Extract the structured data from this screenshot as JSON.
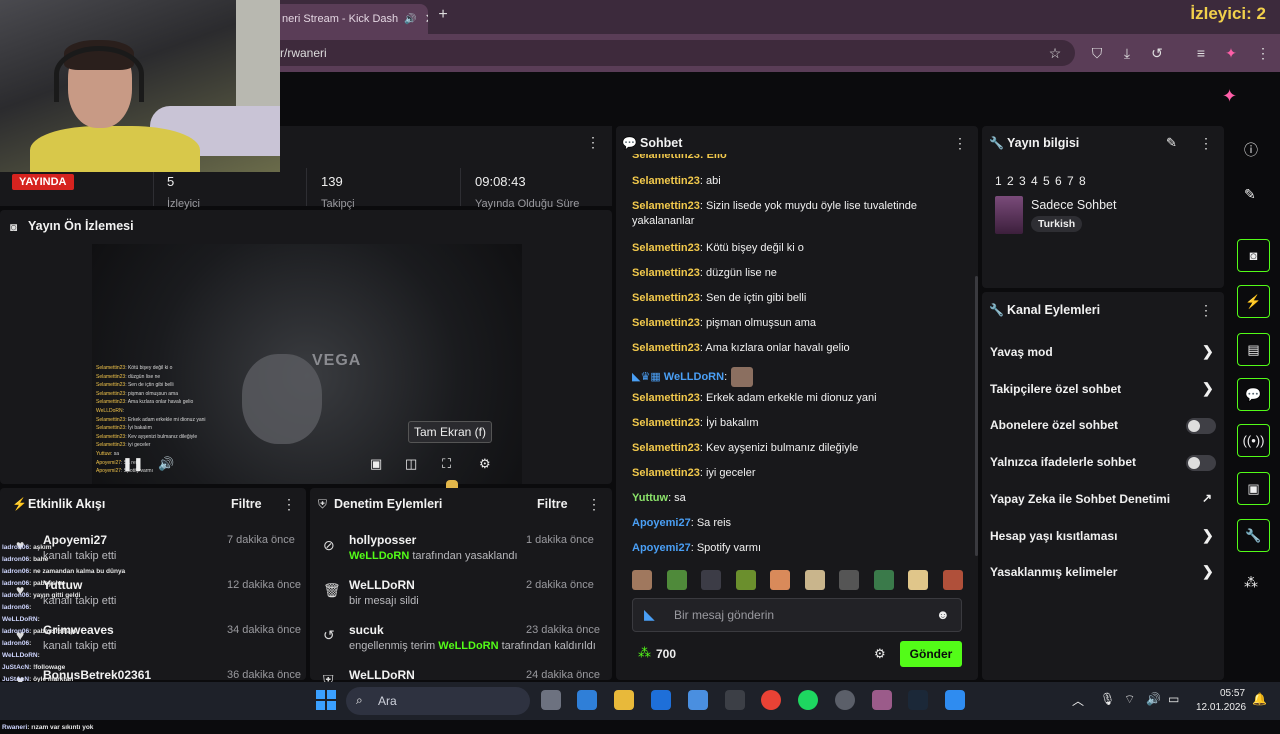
{
  "browser": {
    "tab_title": "neri Stream - Kick Dash",
    "url": "tor/rwaneri",
    "viewer_overlay": "İzleyici: 2"
  },
  "stats": {
    "live_label": "YAYINDA",
    "viewers_value": "5",
    "viewers_label": "İzleyici",
    "followers_value": "139",
    "followers_label": "Takipçi",
    "duration_value": "09:08:43",
    "duration_label": "Yayında Olduğu Süre"
  },
  "preview": {
    "title": "Yayın Ön İzlemesi",
    "vega_text": "VEGA",
    "tooltip": "Tam Ekran (f)",
    "chat_lines": [
      {
        "n": "Selamettin23",
        "t": ": Kötü bişey değil ki o"
      },
      {
        "n": "Selamettin23",
        "t": ": düzgün lise ne"
      },
      {
        "n": "Selamettin23",
        "t": ": Sen de içtin gibi belli"
      },
      {
        "n": "Selamettin23",
        "t": ": pişman olmuşsun ama"
      },
      {
        "n": "Selamettin23",
        "t": ": Ama kızlara onlar havalı gelio"
      },
      {
        "n": "WeLLDoRN",
        "t": ":"
      },
      {
        "n": "Selamettin23",
        "t": ": Erkek adam erkekle mi dionuz yani"
      },
      {
        "n": "Selamettin23",
        "t": ": İyi bakalım"
      },
      {
        "n": "Selamettin23",
        "t": ": Kev ayşenizi bulmanız dileğiyle"
      },
      {
        "n": "Selamettin23",
        "t": ": iyi geceler"
      },
      {
        "n": "Yuttuw",
        "t": ": sa"
      },
      {
        "n": "Apoyemi27",
        "t": ": Sa reis"
      },
      {
        "n": "Apoyemi27",
        "t": ": Spotify varmı"
      }
    ]
  },
  "activity": {
    "title": "Etkinlik Akışı",
    "filter": "Filtre",
    "events": [
      {
        "name": "Apoyemi27",
        "sub": "kanalı takip etti",
        "time": "7 dakika önce"
      },
      {
        "name": "Yuttuw",
        "sub": "kanalı takip etti",
        "time": "12 dakika önce"
      },
      {
        "name": "Grimweaves",
        "sub": "kanalı takip etti",
        "time": "34 dakika önce"
      },
      {
        "name": "BonusBetrek02361",
        "sub": "",
        "time": "36 dakika önce"
      }
    ]
  },
  "overlay_chat": [
    {
      "n": "ladron06",
      "t": ": aşkım"
    },
    {
      "n": "ladron06",
      "t": ": bahe"
    },
    {
      "n": "ladron06",
      "t": ": ne zamandan kalma bu dünya"
    },
    {
      "n": "ladron06",
      "t": ": pabaysha"
    },
    {
      "n": "ladron06",
      "t": ": yayın gitti geldi"
    },
    {
      "n": "ladron06",
      "t": ":"
    },
    {
      "n": "WeLLDoRN",
      "t": ":"
    },
    {
      "n": "ladron06",
      "t": ": pabayshshajs"
    },
    {
      "n": "ladron06",
      "t": ":"
    },
    {
      "n": "WeLLDoRN",
      "t": ":"
    },
    {
      "n": "JuStAcN",
      "t": ": !followage"
    },
    {
      "n": "JuStAcN",
      "t": ": öyle marktan"
    },
    {
      "n": "JuStAcN",
      "t": ": tüm yayınlaeda gezip bakıcam yatıcam"
    },
    {
      "n": "JuStAcN",
      "t": ": merak ettim"
    },
    {
      "n": "JuStAcN",
      "t": ": ben kaçar bb"
    },
    {
      "n": "Rwaneri",
      "t": ": rızam var sıkıntı yok"
    }
  ],
  "moderation": {
    "title": "Denetim Eylemleri",
    "filter": "Filtre",
    "events": [
      {
        "name": "hollyposser",
        "who": "WeLLDoRN",
        "sub": " tarafından yasaklandı",
        "time": "1 dakika önce",
        "icon": "ban-icon"
      },
      {
        "name": "WeLLDoRN",
        "who": "",
        "sub": "bir mesajı sildi",
        "time": "2 dakika önce",
        "icon": "trash-icon"
      },
      {
        "name": "sucuk",
        "who": "",
        "sub": "engellenmiş terim ",
        "who2": "WeLLDoRN",
        "sub2": " tarafından kaldırıldı",
        "time": "23 dakika önce",
        "icon": "undo-icon"
      },
      {
        "name": "WeLLDoRN",
        "who": "",
        "sub": "",
        "time": "24 dakika önce",
        "icon": "shield-icon"
      }
    ]
  },
  "chat": {
    "title": "Sohbet",
    "messages": [
      {
        "u": "Selamettin23",
        "t": ": abi",
        "c": "y"
      },
      {
        "u": "Selamettin23",
        "t": ": Sizin lisede yok muydu öyle lise tuvaletinde yakalananlar",
        "c": "y"
      },
      {
        "u": "Selamettin23",
        "t": ": Kötü bişey değil ki o",
        "c": "y"
      },
      {
        "u": "Selamettin23",
        "t": ": düzgün lise ne",
        "c": "y"
      },
      {
        "u": "Selamettin23",
        "t": ": Sen de içtin gibi belli",
        "c": "y"
      },
      {
        "u": "Selamettin23",
        "t": ": pişman olmuşsun ama",
        "c": "y"
      },
      {
        "u": "Selamettin23",
        "t": ": Ama kızlara onlar havalı gelio",
        "c": "y"
      },
      {
        "u": "WeLLDoRN",
        "t": ":",
        "c": "b"
      },
      {
        "u": "Selamettin23",
        "t": ": Erkek adam erkekle mi dionuz yani",
        "c": "y"
      },
      {
        "u": "Selamettin23",
        "t": ": İyi bakalım",
        "c": "y"
      },
      {
        "u": "Selamettin23",
        "t": ": Kev ayşenizi bulmanız dileğiyle",
        "c": "y"
      },
      {
        "u": "Selamettin23",
        "t": ": iyi geceler",
        "c": "y"
      },
      {
        "u": "Yuttuw",
        "t": ": sa",
        "c": "g"
      },
      {
        "u": "Apoyemi27",
        "t": ": Sa reis",
        "c": "b"
      },
      {
        "u": "Apoyemi27",
        "t": ": Spotify varmı",
        "c": "b"
      }
    ],
    "input_placeholder": "Bir mesaj gönderin",
    "points": "700",
    "send_label": "Gönder"
  },
  "info": {
    "title": "Yayın bilgisi",
    "tags": "1 2 3 4 5 6 7 8",
    "category": "Sadece Sohbet",
    "language": "Turkish"
  },
  "actions": {
    "title": "Kanal Eylemleri",
    "items": [
      {
        "label": "Yavaş mod",
        "control": "chevron"
      },
      {
        "label": "Takipçilere özel sohbet",
        "control": "chevron"
      },
      {
        "label": "Abonelere özel sohbet",
        "control": "toggle"
      },
      {
        "label": "Yalnızca ifadelerle sohbet",
        "control": "toggle"
      },
      {
        "label": "Yapay Zeka ile Sohbet Denetimi",
        "control": "external"
      },
      {
        "label": "Hesap yaşı kısıtlaması",
        "control": "chevron"
      },
      {
        "label": "Yasaklanmış kelimeler",
        "control": "chevron"
      }
    ]
  },
  "taskbar": {
    "search": "Ara",
    "time": "05:57",
    "date": "12.01.2026"
  },
  "colors": {
    "accent": "#53fc18",
    "live": "#d6231f",
    "chat_user_yellow": "#f2c94c",
    "chat_user_blue": "#4a9ff5"
  }
}
